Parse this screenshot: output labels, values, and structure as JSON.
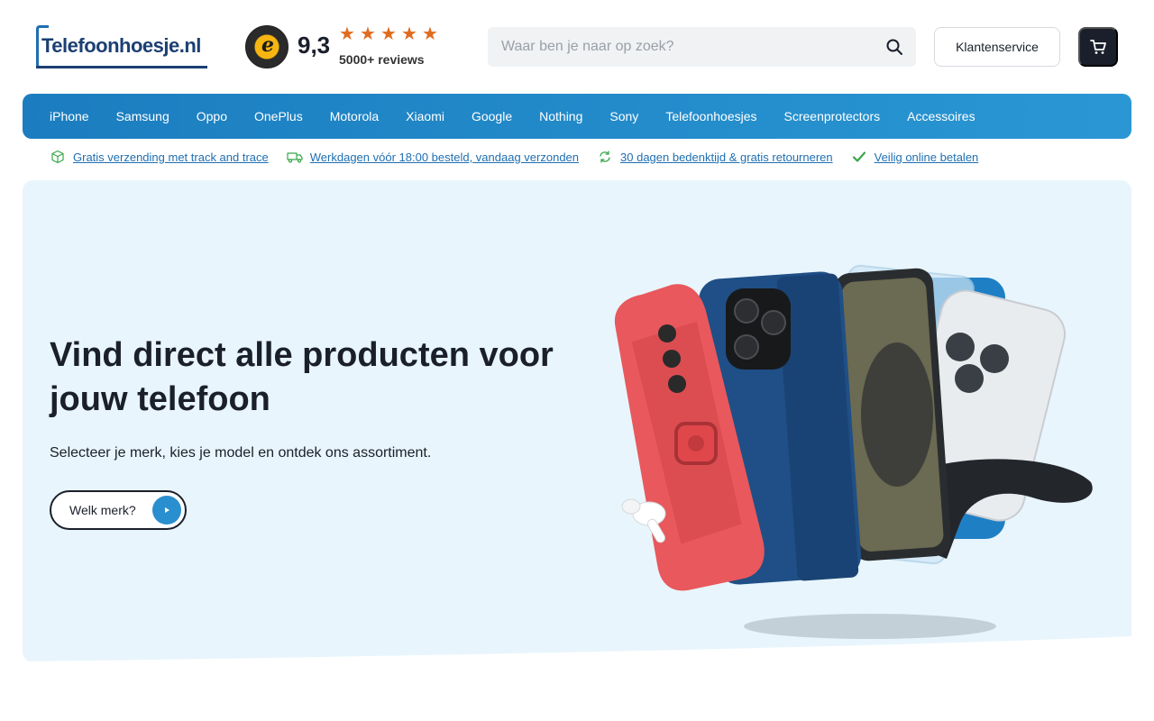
{
  "header": {
    "logo_text": "Telefoonhoesje.nl",
    "trust": {
      "badge_letter": "e",
      "score": "9,3",
      "stars": 5,
      "reviews": "5000+ reviews"
    },
    "search": {
      "placeholder": "Waar ben je naar op zoek?"
    },
    "service_label": "Klantenservice"
  },
  "nav": {
    "items": [
      "iPhone",
      "Samsung",
      "Oppo",
      "OnePlus",
      "Motorola",
      "Xiaomi",
      "Google",
      "Nothing",
      "Sony",
      "Telefoonhoesjes",
      "Screenprotectors",
      "Accessoires"
    ]
  },
  "usps": [
    {
      "icon": "package-icon",
      "label": "Gratis verzending met track and trace"
    },
    {
      "icon": "truck-icon",
      "label": "Werkdagen vóór 18:00 besteld, vandaag verzonden"
    },
    {
      "icon": "recycle-icon",
      "label": "30 dagen bedenktijd & gratis retourneren"
    },
    {
      "icon": "check-icon",
      "label": "Veilig online betalen"
    }
  ],
  "hero": {
    "title": "Vind direct alle producten voor jouw telefoon",
    "subtitle": "Selecteer je merk, kies je model en ontdek ons assortiment.",
    "button_label": "Welk merk?"
  },
  "colors": {
    "brand_blue": "#1f6fb2",
    "nav_blue": "#2a97d4",
    "hero_bg": "#e8f5fc",
    "star_orange": "#e06b1e",
    "dark": "#1a1f2b"
  }
}
